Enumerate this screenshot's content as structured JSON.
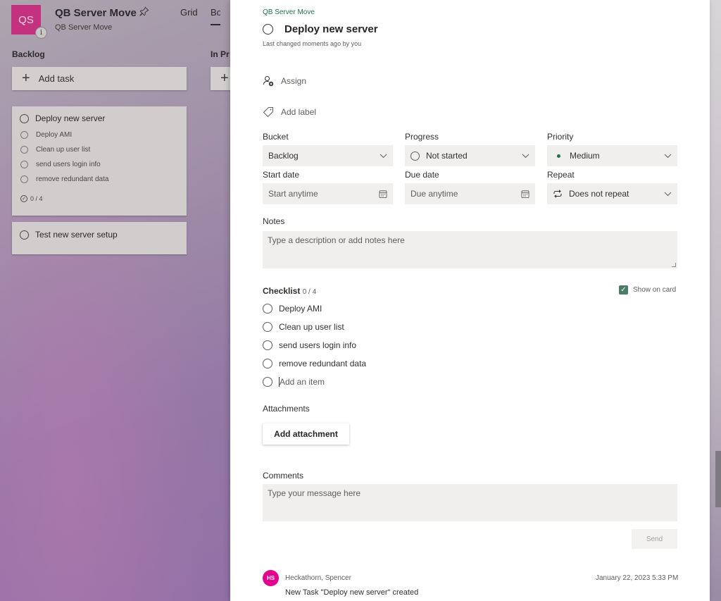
{
  "board": {
    "plan_initials": "QS",
    "plan_name": "QB Server Move",
    "plan_subtitle": "QB Server Move",
    "info_badge": "i",
    "tabs": [
      "Grid",
      "Bo"
    ],
    "buckets": [
      "Backlog",
      "In Pr"
    ],
    "add_task_label": "Add task",
    "cards": [
      {
        "title": "Deploy new server",
        "checklist": [
          "Deploy AMI",
          "Clean up user list",
          "send users login info",
          "remove redundant data"
        ],
        "progress": "0 / 4"
      },
      {
        "title": "Test new server setup"
      }
    ]
  },
  "task": {
    "plan_link": "QB Server Move",
    "title": "Deploy new server",
    "last_changed": "Last changed moments ago by you",
    "assign_label": "Assign",
    "add_label": "Add label",
    "fields": {
      "bucket": {
        "label": "Bucket",
        "value": "Backlog"
      },
      "progress": {
        "label": "Progress",
        "value": "Not started"
      },
      "priority": {
        "label": "Priority",
        "value": "Medium"
      },
      "start_date": {
        "label": "Start date",
        "placeholder": "Start anytime"
      },
      "due_date": {
        "label": "Due date",
        "placeholder": "Due anytime"
      },
      "repeat": {
        "label": "Repeat",
        "value": "Does not repeat"
      }
    },
    "notes": {
      "label": "Notes",
      "placeholder": "Type a description or add notes here"
    },
    "checklist": {
      "label": "Checklist",
      "count": "0 / 4",
      "show_on_card": "Show on card",
      "show_on_card_checked": true,
      "items": [
        "Deploy AMI",
        "Clean up user list",
        "send users login info",
        "remove redundant data"
      ],
      "add_placeholder": "Add an item"
    },
    "attachments": {
      "label": "Attachments",
      "button": "Add attachment"
    },
    "comments": {
      "label": "Comments",
      "placeholder": "Type your message here",
      "send": "Send",
      "entries": [
        {
          "initials": "HS",
          "author": "Heckathorn, Spencer",
          "date": "January 22, 2023 5:33 PM",
          "text": "New Task \"Deploy new server\" created"
        }
      ]
    }
  },
  "colors": {
    "accent_green": "#217346",
    "plan_avatar": "#c4317f",
    "comment_avatar": "#e3008c"
  }
}
